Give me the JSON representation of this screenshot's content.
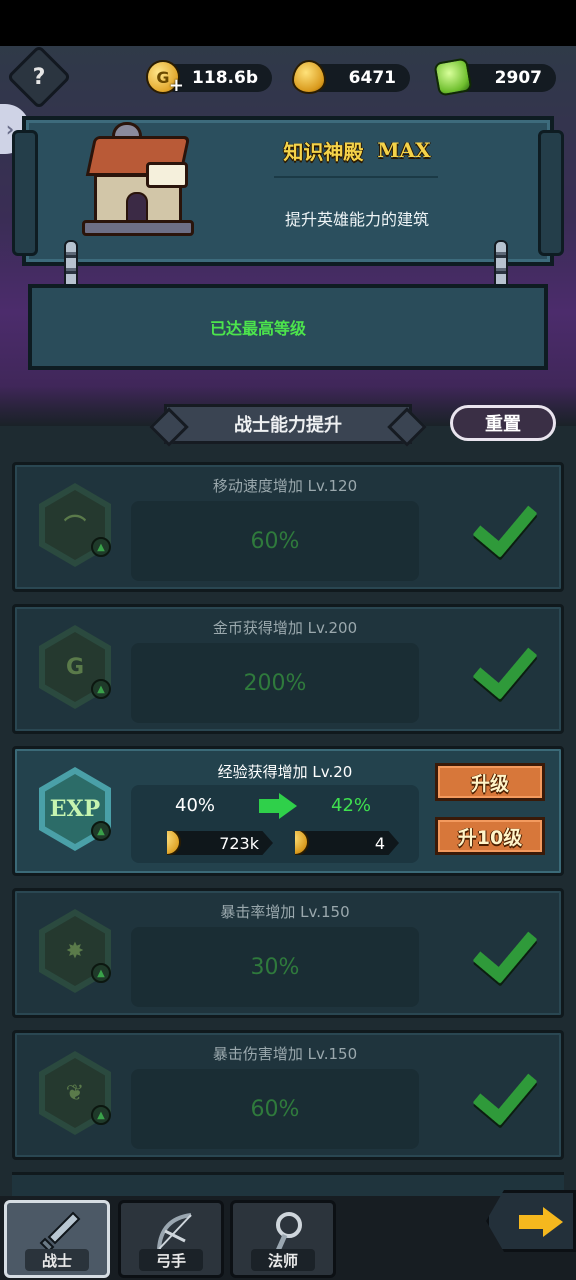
{
  "resources": [
    {
      "icon": "gold-coin-plus-icon",
      "value": "118.6b"
    },
    {
      "icon": "gold-drop-icon",
      "value": "6471"
    },
    {
      "icon": "green-gem-icon",
      "value": "2907"
    }
  ],
  "help_label": "?",
  "building": {
    "name": "知识神殿",
    "level_badge": "MAX",
    "description": "提升英雄能力的建筑",
    "status": "已达最高等级"
  },
  "section": {
    "title": "战士能力提升",
    "reset_label": "重置"
  },
  "upgrades": [
    {
      "icon": "boot-icon",
      "title": "移动速度增加 Lv.120",
      "value": "60%",
      "maxed": true
    },
    {
      "icon": "gold-icon",
      "glyph": "G",
      "title": "金币获得增加 Lv.200",
      "value": "200%",
      "maxed": true
    },
    {
      "icon": "exp-icon",
      "glyph": "EXP",
      "title": "经验获得增加 Lv.20",
      "current": "40%",
      "next": "42%",
      "cost_gold": "723k",
      "cost_drop": "4",
      "upgrade_label": "升级",
      "upgrade10_label": "升10级",
      "maxed": false
    },
    {
      "icon": "crit-burst-icon",
      "title": "暴击率增加 Lv.150",
      "value": "30%",
      "maxed": true
    },
    {
      "icon": "leaf-icon",
      "title": "暴击伤害增加 Lv.150",
      "value": "60%",
      "maxed": true
    }
  ],
  "tabs": [
    {
      "label": "战士",
      "icon": "sword-icon",
      "selected": true
    },
    {
      "label": "弓手",
      "icon": "bow-icon",
      "selected": false
    },
    {
      "label": "法师",
      "icon": "staff-icon",
      "selected": false
    }
  ],
  "colors": {
    "accent_gold": "#f4d34a",
    "maxed_green": "#2f9a3a",
    "upgrade_orange": "#d7773a",
    "status_green": "#4ce44c"
  }
}
